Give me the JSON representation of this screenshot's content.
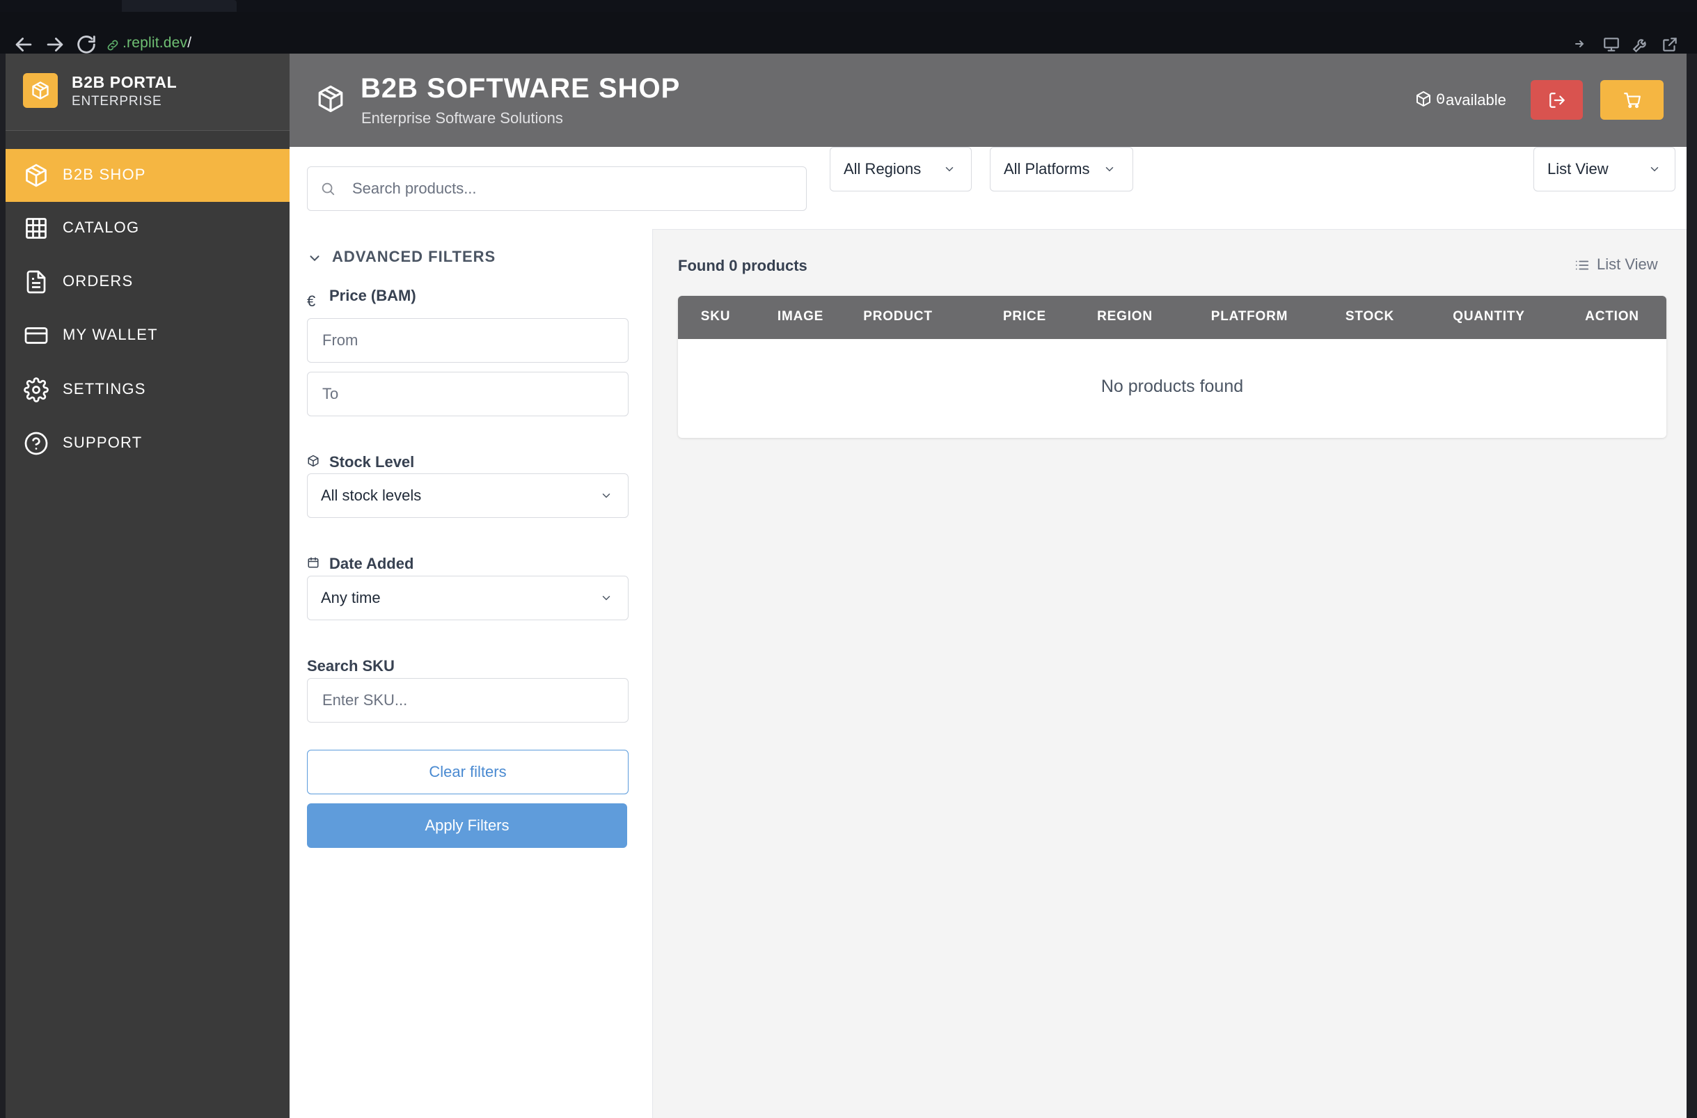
{
  "browser": {
    "url_host": ".replit.dev",
    "url_path": "/"
  },
  "sidebar": {
    "brand_title": "B2B PORTAL",
    "brand_subtitle": "ENTERPRISE",
    "items": [
      {
        "label": "B2B SHOP",
        "icon": "package-icon",
        "active": true
      },
      {
        "label": "CATALOG",
        "icon": "grid-icon",
        "active": false
      },
      {
        "label": "ORDERS",
        "icon": "document-icon",
        "active": false
      },
      {
        "label": "MY WALLET",
        "icon": "credit-card-icon",
        "active": false
      },
      {
        "label": "SETTINGS",
        "icon": "gear-icon",
        "active": false
      },
      {
        "label": "SUPPORT",
        "icon": "help-circle-icon",
        "active": false
      }
    ]
  },
  "header": {
    "title": "B2B SOFTWARE SHOP",
    "subtitle": "Enterprise Software Solutions",
    "available_count": "0",
    "available_label": "available"
  },
  "toolbar": {
    "search_placeholder": "Search products...",
    "region_select": "All Regions",
    "platform_select": "All Platforms",
    "view_select": "List View"
  },
  "filters": {
    "toggle_label": "ADVANCED FILTERS",
    "price_label": "Price (BAM)",
    "price_symbol": "€",
    "price_from_placeholder": "From",
    "price_to_placeholder": "To",
    "stock_label": "Stock Level",
    "stock_value": "All stock levels",
    "date_label": "Date Added",
    "date_value": "Any time",
    "sku_label": "Search SKU",
    "sku_placeholder": "Enter SKU...",
    "clear_label": "Clear filters",
    "apply_label": "Apply Filters"
  },
  "results": {
    "found_text": "Found 0 products",
    "view_label": "List View",
    "columns": [
      "SKU",
      "IMAGE",
      "PRODUCT",
      "PRICE",
      "REGION",
      "PLATFORM",
      "STOCK",
      "QUANTITY",
      "ACTION"
    ],
    "empty_text": "No products found"
  },
  "colors": {
    "accent": "#f5b642",
    "sidebar_bg": "#3a3a3a",
    "header_bg": "#6b6b6d",
    "danger": "#d9534f",
    "primary": "#5f9cdb"
  }
}
